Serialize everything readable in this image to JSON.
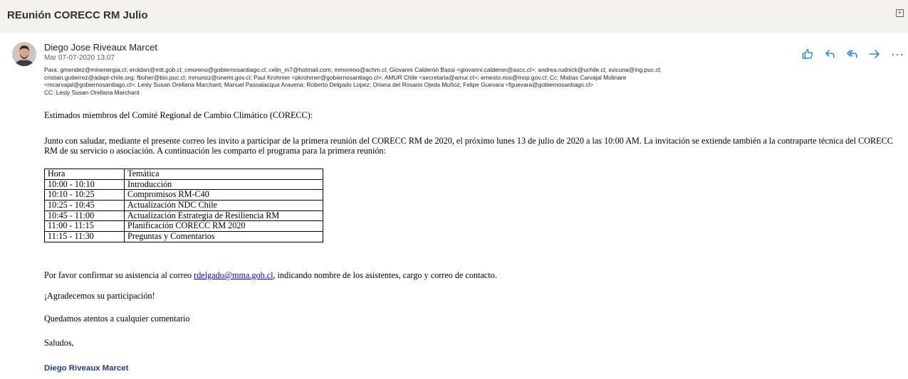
{
  "message": {
    "subject": "REunión CORECC RM Julio",
    "sender_name": "Diego Jose Riveaux Marcet",
    "date": "Mar 07-07-2020 13:07",
    "recipients": {
      "to_line_1": "Para:  gmendez@minenergia.cl; eroldan@mtt.gob.cl; cmoreno@gobiernosantiago.cl; celin_m7@hotmail.com; mmoreno@achm.cl; Giovanni Calderón Bassi <giovanni.calderon@ascc.cl>; andrea.rudnick@uchile.cl; svicuna@ing.puc.cl;",
      "to_line_2": "cristian.gutierrez@adapt-chile.org; fboher@bio.puc.cl; mmunoz@onemi.gov.cl; Paul Krohmer <pkrohmer@gobiernosantiago.cl>; AMUR Chile <secretaria@amur.cl>; ernesto.rios@mop.gov.cl; Cc: Matías Carvajal Molinare",
      "to_line_3": "<mcarvajal@gobiernosantiago.cl>; Lesly Susan Orellana Marchant; Manuel Passalacqua Aravena; Roberto Delgado Lopez; Oriana del Rosario Ojeda Muñoz; Felipe Guevara <fguevara@gobiernosantiago.cl>",
      "cc_line": "CC:  Lesly Susan Orellana Marchant"
    }
  },
  "actions": {
    "like": "like-icon",
    "reply": "reply-icon",
    "reply_all": "reply-all-icon",
    "forward": "forward-icon",
    "more": "more-icon",
    "accent_color": "#0078d4"
  },
  "body": {
    "greeting": "Estimados miembros del Comité Regional de Cambio Climático (CORECC):",
    "intro": "Junto con saludar, mediante el presente correo les invito a participar de la primera reunión del CORECC RM de 2020, el próximo lunes 13 de julio de 2020 a las 10:00 AM. La invitación se extiende también a la contraparte técnica del CORECC RM de su servicio o asociación. A continuación les comparto el programa para la primera reunión:",
    "agenda": {
      "headers": [
        "Hora",
        "Temática"
      ],
      "rows": [
        [
          "10:00 - 10:10",
          "Introducción"
        ],
        [
          "10:10 - 10:25",
          "Compromisos RM-C40"
        ],
        [
          "10:25 - 10:45",
          "Actualización NDC Chile"
        ],
        [
          "10:45 - 11:00",
          "Actualización Estrategia de Resiliencia RM"
        ],
        [
          "11:00 - 11:15",
          "Planificación CORECC RM 2020"
        ],
        [
          "11:15 - 11:30",
          "Preguntas y Comentarios"
        ]
      ]
    },
    "confirm_before": "Por favor confirmar su asistencia al correo ",
    "confirm_link": "rdelgado@mma.gob.cl",
    "confirm_after": ", indicando nombre de los asistentes, cargo y correo de contacto.",
    "thanks": "¡Agradecemos su participación!",
    "closing_note": "Quedamos atentos a cualquier comentario",
    "regards": "Saludos,",
    "signature": "Diego Riveaux Marcet"
  }
}
